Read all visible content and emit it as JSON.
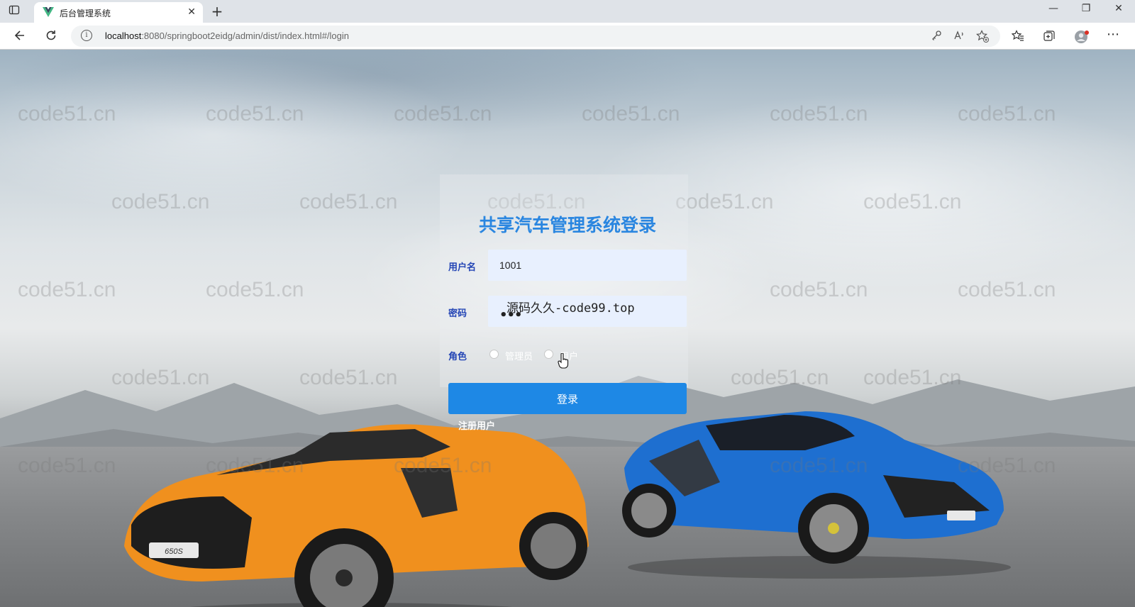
{
  "browser": {
    "tab_title": "后台管理系统",
    "new_tab": "+",
    "tab_close": "✕",
    "url_host": "localhost",
    "url_rest": ":8080/springboot2eidg/admin/dist/index.html#/login",
    "window_controls": [
      "—",
      "❐",
      "✕"
    ]
  },
  "watermark": {
    "text": "code51.cn",
    "overlay": "源码久久-code99.top"
  },
  "login": {
    "title": "共享汽车管理系统登录",
    "username_label": "用户名",
    "username_value": "1001",
    "password_label": "密码",
    "password_dots": "•••",
    "role_label": "角色",
    "role_options": [
      "管理员",
      "用户"
    ],
    "submit_label": "登录",
    "register_link": "注册用户"
  },
  "colors": {
    "title": "#2a86e0",
    "label": "#2445b5",
    "button": "#1e88e5",
    "input_bg": "#e8f0fe"
  },
  "icons": {
    "tab_actions": "tab-actions-icon",
    "favicon": "vue-logo-icon",
    "back": "back-arrow-icon",
    "reload": "reload-icon",
    "info": "site-info-icon",
    "key": "key-icon",
    "read_aloud": "read-aloud-icon",
    "add_favorite": "add-favorite-icon",
    "favorites": "favorites-icon",
    "collections": "collections-icon",
    "profile": "profile-icon",
    "more": "more-icon"
  }
}
